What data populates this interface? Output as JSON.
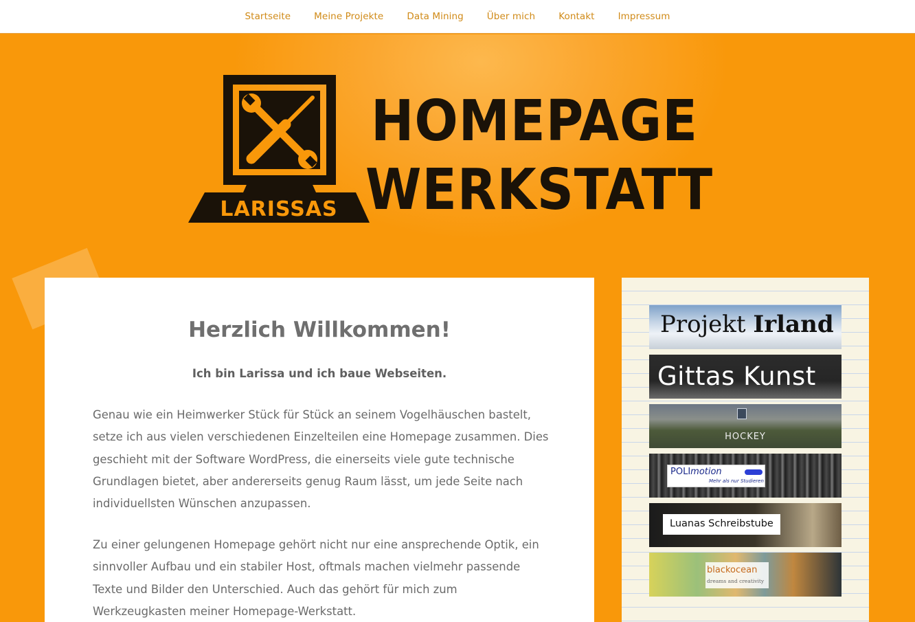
{
  "nav": {
    "items": [
      {
        "label": "Startseite"
      },
      {
        "label": "Meine Projekte"
      },
      {
        "label": "Data Mining"
      },
      {
        "label": "Über mich"
      },
      {
        "label": "Kontakt"
      },
      {
        "label": "Impressum"
      }
    ]
  },
  "colors": {
    "page_background": "#f9980a",
    "nav_link": "#d08a17",
    "logo_ink": "#1a1208"
  },
  "logo": {
    "line1": "HOMEPAGE",
    "line2": "WERKSTATT",
    "badge": "LARISSAS",
    "icon": "wrench-screwdriver-monitor-icon"
  },
  "main": {
    "title": "Herzlich Willkommen!",
    "lead": "Ich bin Larissa und ich baue Webseiten.",
    "paragraphs": [
      "Genau wie ein Heimwerker Stück für Stück an seinem Vogelhäuschen bastelt, setze ich aus vielen verschiedenen Einzelteilen eine Homepage zusammen. Dies geschieht mit der Software WordPress, die einerseits viele gute technische Grundlagen bietet, aber andererseits genug Raum lässt, um jede Seite nach individuellsten Wünschen anzupassen.",
      "Zu einer gelungenen Homepage gehört nicht nur eine ansprechende Optik, ein sinnvoller Aufbau und ein stabiler Host, oftmals machen vielmehr passende Texte und Bilder den Unterschied. Auch das gehört für mich zum Werkzeugkasten meiner Homepage-Werkstatt."
    ]
  },
  "sidebar": {
    "banners": {
      "irland": {
        "word1": "Projekt",
        "word2": "Irland"
      },
      "gittas": {
        "label": "Gittas Kunst"
      },
      "hockey": {
        "label": "HOCKEY"
      },
      "polimotion": {
        "label_a": "POLI",
        "label_b": "motion",
        "sub": "Mehr als nur Studieren"
      },
      "luanas": {
        "label": "Luanas Schreibstube"
      },
      "blackocean": {
        "label": "blackocean",
        "sub": "dreams and creativity"
      }
    }
  }
}
